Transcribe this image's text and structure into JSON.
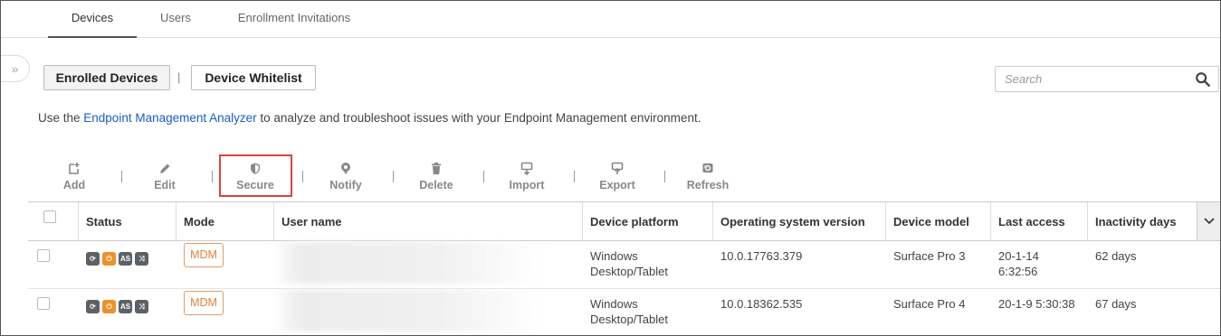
{
  "tabs": [
    {
      "label": "Devices",
      "active": true
    },
    {
      "label": "Users",
      "active": false
    },
    {
      "label": "Enrollment Invitations",
      "active": false
    }
  ],
  "collapse_toggle": "»",
  "segments": {
    "enrolled": "Enrolled Devices",
    "separator": "|",
    "whitelist": "Device Whitelist"
  },
  "search": {
    "placeholder": "Search",
    "icon": "search-icon"
  },
  "info": {
    "prefix": "Use the ",
    "link": "Endpoint Management Analyzer",
    "suffix": " to analyze and troubleshoot issues with your Endpoint Management environment."
  },
  "toolbar": {
    "add": "Add",
    "edit": "Edit",
    "secure": "Secure",
    "notify": "Notify",
    "delete": "Delete",
    "import": "Import",
    "export": "Export",
    "refresh": "Refresh"
  },
  "table": {
    "columns": [
      "Status",
      "Mode",
      "User name",
      "Device platform",
      "Operating system version",
      "Device model",
      "Last access",
      "Inactivity days"
    ],
    "rows": [
      {
        "mode": "MDM",
        "platform_line1": "Windows",
        "platform_line2": "Desktop/Tablet",
        "os_version": "10.0.17763.379",
        "model": "Surface Pro 3",
        "last_access_line1": "20-1-14",
        "last_access_line2": "6:32:56",
        "inactivity": "62 days"
      },
      {
        "mode": "MDM",
        "platform_line1": "Windows",
        "platform_line2": "Desktop/Tablet",
        "os_version": "10.0.18362.535",
        "model": "Surface Pro 4",
        "last_access_line1": "20-1-9 5:30:38",
        "last_access_line2": "",
        "inactivity": "67 days"
      }
    ],
    "status_icon_label": "AS"
  },
  "colors": {
    "accent_link": "#1a5dc5",
    "highlight": "#d9443f",
    "mdm_badge": "#e0813a",
    "status_orange": "#f08f2a"
  }
}
